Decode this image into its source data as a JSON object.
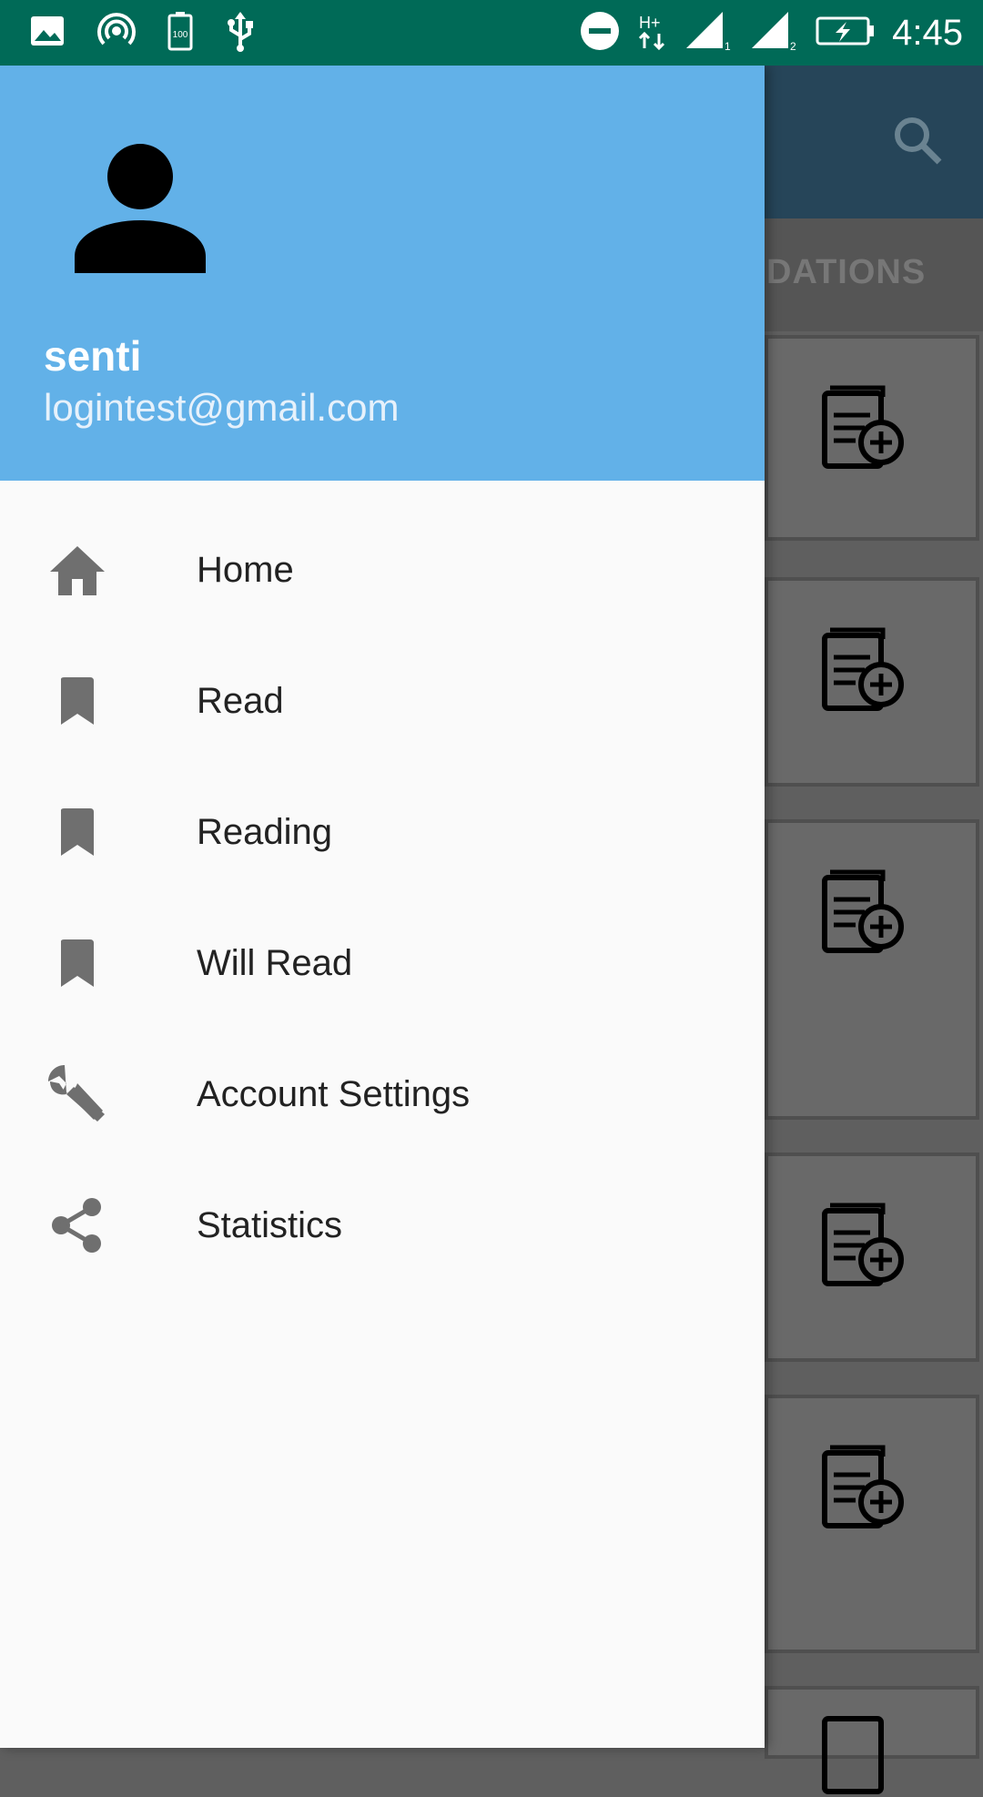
{
  "status_bar": {
    "time": "4:45",
    "battery_label": "100",
    "network_label": "H+"
  },
  "background": {
    "tab_label": "DATIONS"
  },
  "drawer": {
    "user": {
      "name": "senti",
      "email": "logintest@gmail.com"
    },
    "items": [
      {
        "label": "Home",
        "icon": "home-icon"
      },
      {
        "label": "Read",
        "icon": "bookmark-icon"
      },
      {
        "label": "Reading",
        "icon": "bookmark-icon"
      },
      {
        "label": "Will Read",
        "icon": "bookmark-icon"
      },
      {
        "label": "Account Settings",
        "icon": "wrench-icon"
      },
      {
        "label": "Statistics",
        "icon": "share-icon"
      }
    ]
  },
  "colors": {
    "status_bar": "#006a57",
    "drawer_header": "#62b1e8",
    "toolbar": "#264559"
  }
}
